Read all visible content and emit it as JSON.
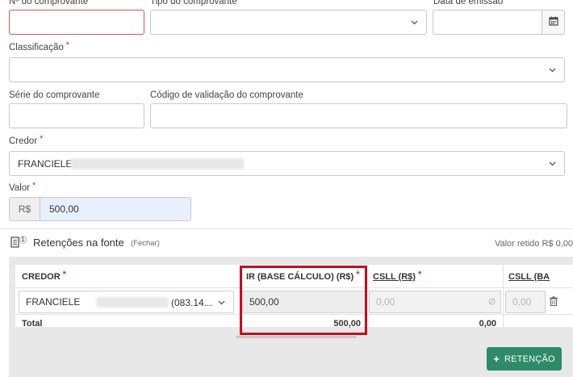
{
  "form": {
    "numero_label": "Nº do comprovante",
    "tipo_label": "Tipo do comprovante",
    "data_label": "Data de emissão",
    "classificacao_label": "Classificação",
    "serie_label": "Série do comprovante",
    "codigo_label": "Código de validação do comprovante",
    "credor_label": "Credor",
    "credor_value": "FRANCIELE",
    "valor_label": "Valor",
    "valor_prefix": "R$",
    "valor_value": "500,00",
    "required_mark": "*"
  },
  "retencoes": {
    "badge": "1",
    "title": "Retenções na fonte",
    "fechar": "(Fechar)",
    "valor_retido": "Valor retido R$ 0,00",
    "columns": {
      "credor": "CREDOR",
      "ir": "IR (BASE CÁLCULO) (R$)",
      "csll": "CSLL (R$)",
      "csll_ba": "CSLL (BA"
    },
    "row": {
      "credor_name": "FRANCIELE",
      "credor_doc": "(083.14...",
      "ir_value": "500,00",
      "csll_value": "0,00",
      "csll_ba_value": "0,00"
    },
    "total": {
      "label": "Total",
      "ir": "500,00",
      "csll": "0,00"
    },
    "add_button": "RETENÇÃO"
  }
}
